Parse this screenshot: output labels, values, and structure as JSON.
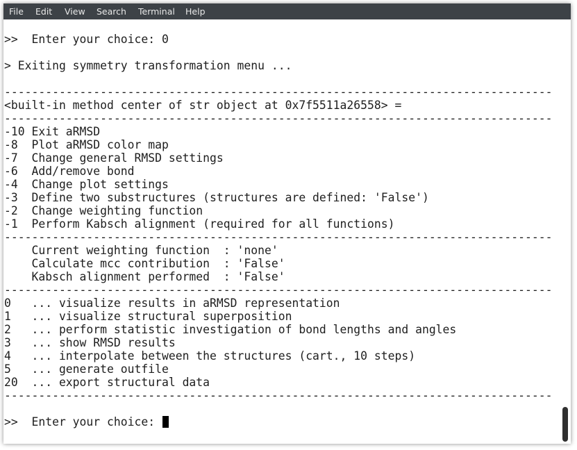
{
  "menubar": {
    "items": [
      "File",
      "Edit",
      "View",
      "Search",
      "Terminal",
      "Help"
    ]
  },
  "terminal": {
    "lines": [
      "",
      ">>  Enter your choice: 0",
      "",
      "> Exiting symmetry transformation menu ...",
      "",
      "--------------------------------------------------------------------------------",
      "<built-in method center of str object at 0x7f5511a26558> =",
      "--------------------------------------------------------------------------------",
      "-10 Exit aRMSD",
      "-8  Plot aRMSD color map",
      "-7  Change general RMSD settings",
      "-6  Add/remove bond",
      "-4  Change plot settings",
      "-3  Define two substructures (structures are defined: 'False')",
      "-2  Change weighting function",
      "-1  Perform Kabsch alignment (required for all functions)",
      "--------------------------------------------------------------------------------",
      "    Current weighting function  : 'none'",
      "    Calculate mcc contribution  : 'False'",
      "    Kabsch alignment performed  : 'False'",
      "--------------------------------------------------------------------------------",
      "0   ... visualize results in aRMSD representation",
      "1   ... visualize structural superposition",
      "2   ... perform statistic investigation of bond lengths and angles",
      "3   ... show RMSD results",
      "4   ... interpolate between the structures (cart., 10 steps)",
      "5   ... generate outfile",
      "20  ... export structural data",
      "--------------------------------------------------------------------------------",
      "",
      ">>  Enter your choice: "
    ]
  },
  "colors": {
    "menubar_bg": "#3d4247",
    "menubar_text": "#e8e8e8",
    "terminal_bg": "#ffffff",
    "terminal_text": "#1e1e1e",
    "cursor": "#000000"
  }
}
